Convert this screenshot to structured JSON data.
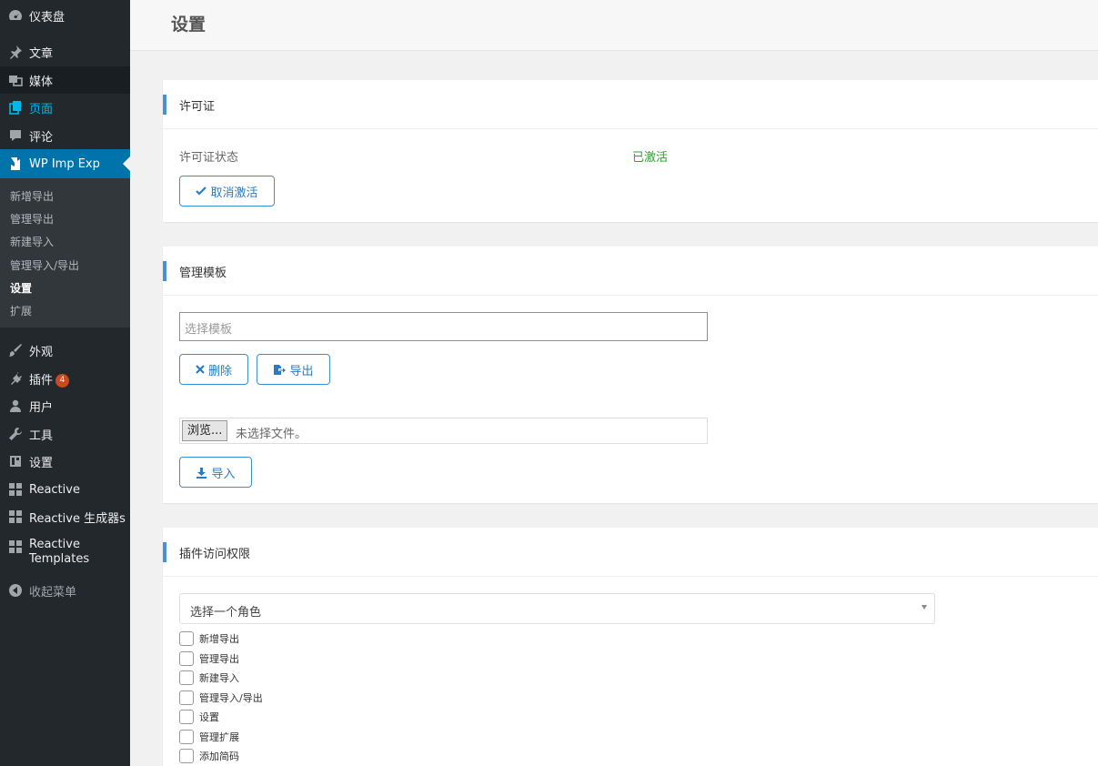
{
  "sidebar": {
    "items": [
      {
        "label": "仪表盘",
        "icon": "dashboard-icon"
      },
      {
        "label": "文章",
        "icon": "pin-icon"
      },
      {
        "label": "媒体",
        "icon": "media-icon"
      },
      {
        "label": "页面",
        "icon": "pages-icon"
      },
      {
        "label": "评论",
        "icon": "comment-icon"
      },
      {
        "label": "WP Imp Exp",
        "icon": "import-export-icon"
      },
      {
        "label": "外观",
        "icon": "brush-icon"
      },
      {
        "label": "插件",
        "icon": "plugin-icon",
        "badge": "4"
      },
      {
        "label": "用户",
        "icon": "user-icon"
      },
      {
        "label": "工具",
        "icon": "wrench-icon"
      },
      {
        "label": "设置",
        "icon": "settings-icon"
      },
      {
        "label": "Reactive",
        "icon": "grid-icon"
      },
      {
        "label": "Reactive 生成器s",
        "icon": "grid-icon"
      },
      {
        "label": "Reactive Templates",
        "icon": "grid-icon"
      },
      {
        "label": "收起菜单",
        "icon": "collapse-icon"
      }
    ],
    "submenu": [
      "新增导出",
      "管理导出",
      "新建导入",
      "管理导入/导出",
      "设置",
      "扩展"
    ]
  },
  "header": {
    "title": "设置"
  },
  "license": {
    "title": "许可证",
    "status_label": "许可证状态",
    "status_value": "已激活",
    "deactivate_label": "取消激活"
  },
  "templates": {
    "title": "管理模板",
    "select_placeholder": "选择模板",
    "delete_label": "删除",
    "export_label": "导出",
    "browse_label": "浏览...",
    "file_none": "未选择文件。",
    "import_label": "导入"
  },
  "access": {
    "title": "插件访问权限",
    "role_select": "选择一个角色",
    "permissions": [
      "新增导出",
      "管理导出",
      "新建导入",
      "管理导入/导出",
      "设置",
      "管理扩展",
      "添加简码"
    ]
  },
  "colors": {
    "sidebar_bg": "#23282d",
    "current": "#0073aa",
    "accent": "#00b9eb",
    "ok": "#2aa32a",
    "button": "#3a8fd1",
    "badge": "#ca4a1f"
  }
}
